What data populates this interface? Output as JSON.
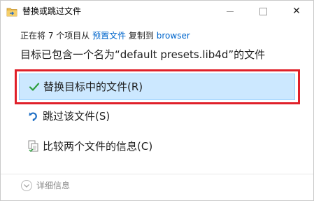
{
  "titlebar": {
    "title": "替换或跳过文件",
    "app_icon": "folder-move-icon",
    "window_buttons": [
      "minimize-icon",
      "maximize-icon",
      "close-icon"
    ],
    "close_glyph": "✕"
  },
  "subtitle": {
    "prefix": "正在将 7 个项目从 ",
    "source": "预置文件",
    "middle": " 复制到 ",
    "destination": "browser"
  },
  "heading": "目标已包含一个名为“default presets.lib4d”的文件",
  "options": {
    "replace": {
      "label": "替换目标中的文件(R)",
      "icon": "checkmark-icon"
    },
    "skip": {
      "label": "跳过该文件(S)",
      "icon": "skip-arrow-icon"
    },
    "compare": {
      "label": "比较两个文件的信息(C)",
      "icon": "compare-files-icon"
    }
  },
  "footer": {
    "details_label": "详细信息",
    "details_icon": "chevron-down-icon"
  },
  "colors": {
    "link": "#0066cc",
    "selected_bg": "#cce8ff",
    "selected_border": "#99d1ff",
    "highlight_frame": "#e0202a",
    "check_green": "#2e9e3e",
    "skip_blue": "#1f6fc5"
  }
}
